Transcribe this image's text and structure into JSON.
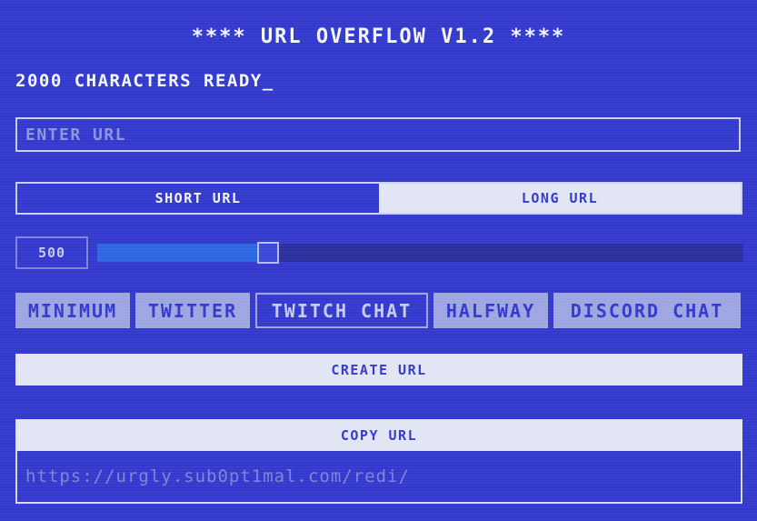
{
  "app": {
    "title": "**** URL OVERFLOW V1.2 ****",
    "status": "2000 CHARACTERS READY_"
  },
  "url_input": {
    "placeholder": "ENTER URL",
    "value": ""
  },
  "mode_toggle": {
    "options": [
      {
        "label": "SHORT URL",
        "selected": true
      },
      {
        "label": "LONG URL",
        "selected": false
      }
    ]
  },
  "length": {
    "value": "500",
    "min": 0,
    "max": 2000,
    "fraction": 0.25
  },
  "presets": [
    {
      "label": "MINIMUM",
      "selected": false
    },
    {
      "label": "TWITTER",
      "selected": false
    },
    {
      "label": "TWITCH CHAT",
      "selected": true
    },
    {
      "label": "HALFWAY",
      "selected": false
    },
    {
      "label": "DISCORD CHAT",
      "selected": false
    }
  ],
  "actions": {
    "create_label": "CREATE URL",
    "copy_label": "COPY URL"
  },
  "output": {
    "text": "https://urgly.sub0pt1mal.com/redi/"
  },
  "colors": {
    "background": "#3339cc",
    "accent": "#e2e5f4",
    "slider_fill": "#2b67e0",
    "muted": "#7d85d6"
  }
}
